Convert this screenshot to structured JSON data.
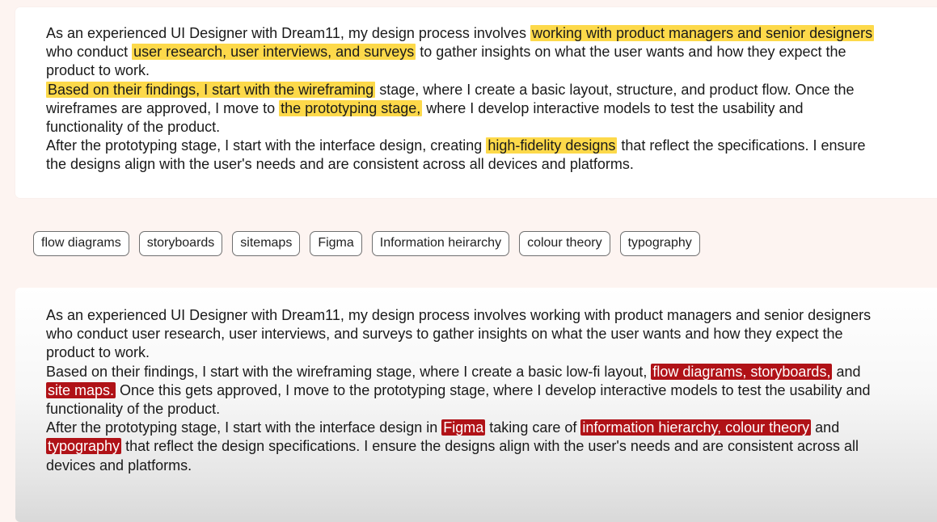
{
  "top_card": {
    "l1": {
      "a": "As an experienced UI Designer with Dream11, my design process involves ",
      "h": "working with product managers and senior designers"
    },
    "l2": {
      "a": "who conduct ",
      "h": "user research, user interviews, and surveys",
      "b": " to gather insights on what the user wants and how they expect the"
    },
    "l3": "product to work.",
    "l4": {
      "h": "Based on their findings, I start with the wireframing",
      "b": " stage, where I create a basic layout, structure, and product flow. Once the"
    },
    "l5": {
      "a": "wireframes are approved, I move to ",
      "h": "the prototyping stage,",
      "b": " where I develop interactive models to test the usability and"
    },
    "l6": "functionality of the product.",
    "l7": {
      "a": "After the prototyping stage, I start with the interface design, creating ",
      "h": "high-fidelity designs",
      "b": " that reflect the specifications. I ensure"
    },
    "l8": "the designs align with the user's needs and are consistent across all devices and platforms."
  },
  "tags": [
    "flow diagrams",
    "storyboards",
    "sitemaps",
    "Figma",
    "Information heirarchy",
    "colour theory",
    "typography"
  ],
  "bottom_card": {
    "l1": "As an experienced UI Designer with Dream11, my design process involves working with product managers and senior designers",
    "l2": "who conduct user research, user interviews, and surveys to gather insights on what the user wants and how they expect the",
    "l3": "product to work.",
    "l4": {
      "a": "Based on their findings, I start with the wireframing stage, where I create a basic low-fi layout, ",
      "h": "flow diagrams, storyboards,",
      "b": " and"
    },
    "l5": {
      "h": "site maps.",
      "b": " Once this gets approved, I move to the prototyping stage, where I develop interactive models to test the usability and"
    },
    "l6": "functionality of the product.",
    "l7": {
      "a": "After the prototyping stage, I start with the interface design in ",
      "h1": "Figma",
      "b": " taking care of ",
      "h2": "information hierarchy, colour theory",
      "c": " and"
    },
    "l8": {
      "h": "typography",
      "b": " that reflect the design specifications. I ensure the designs align with the user's needs and are consistent across all"
    },
    "l9": "devices and platforms."
  },
  "colors": {
    "highlight_yellow": "#fdd94a",
    "highlight_red": "#b01217"
  }
}
